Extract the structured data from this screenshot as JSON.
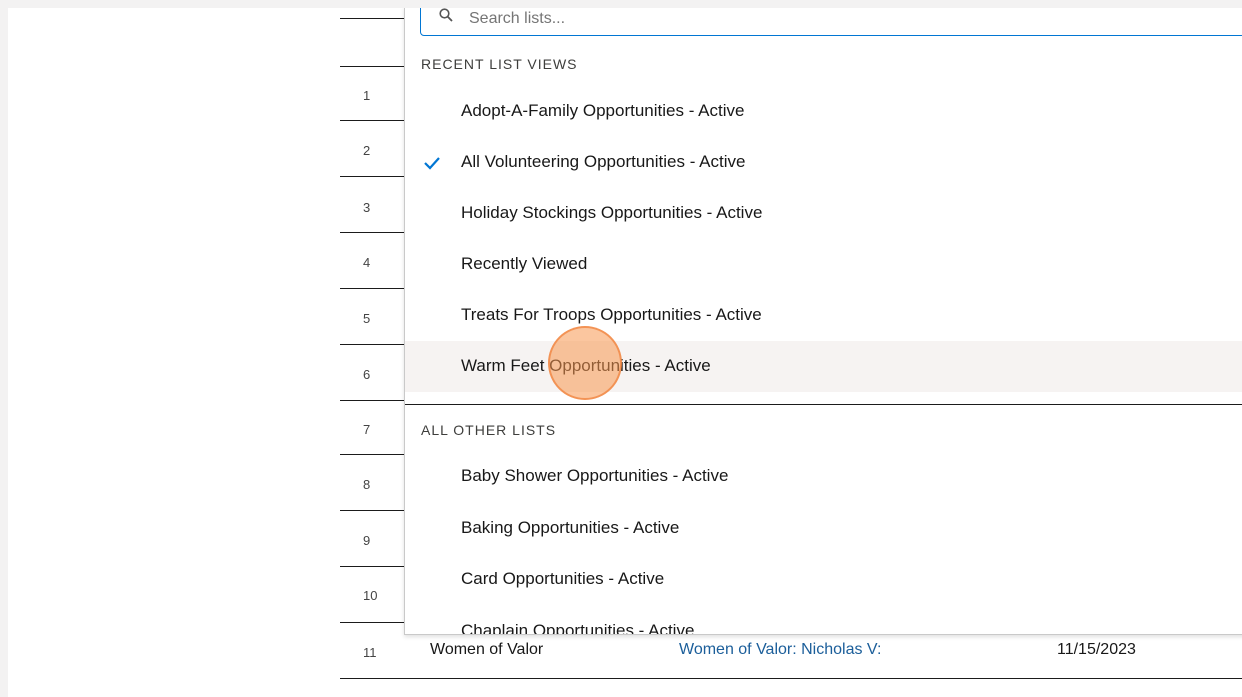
{
  "search": {
    "placeholder": "Search lists..."
  },
  "dropdown": {
    "recent_header": "RECENT LIST VIEWS",
    "recent": [
      {
        "label": "Adopt-A-Family Opportunities - Active",
        "selected": false
      },
      {
        "label": "All Volunteering Opportunities - Active",
        "selected": true
      },
      {
        "label": "Holiday Stockings Opportunities - Active",
        "selected": false
      },
      {
        "label": "Recently Viewed",
        "selected": false
      },
      {
        "label": "Treats For Troops Opportunities - Active",
        "selected": false
      },
      {
        "label": "Warm Feet Opportunities - Active",
        "selected": false,
        "hovered": true
      }
    ],
    "other_header": "ALL OTHER LISTS",
    "other": [
      {
        "label": "Baby Shower Opportunities - Active"
      },
      {
        "label": "Baking Opportunities - Active"
      },
      {
        "label": "Card Opportunities - Active"
      },
      {
        "label": "Chaplain Opportunities - Active"
      }
    ]
  },
  "table": {
    "row_numbers": [
      "1",
      "2",
      "3",
      "4",
      "5",
      "6",
      "7",
      "8",
      "9",
      "10",
      "11"
    ],
    "visible_row": {
      "number": "11",
      "name": "Women of Valor",
      "opportunity": "Women of Valor: Nicholas V:",
      "date": "11/15/2023"
    }
  },
  "colors": {
    "accent": "#0176d3",
    "link": "#1b5e9a",
    "hover": "#f6f3f2",
    "cursor": "#f79850"
  }
}
